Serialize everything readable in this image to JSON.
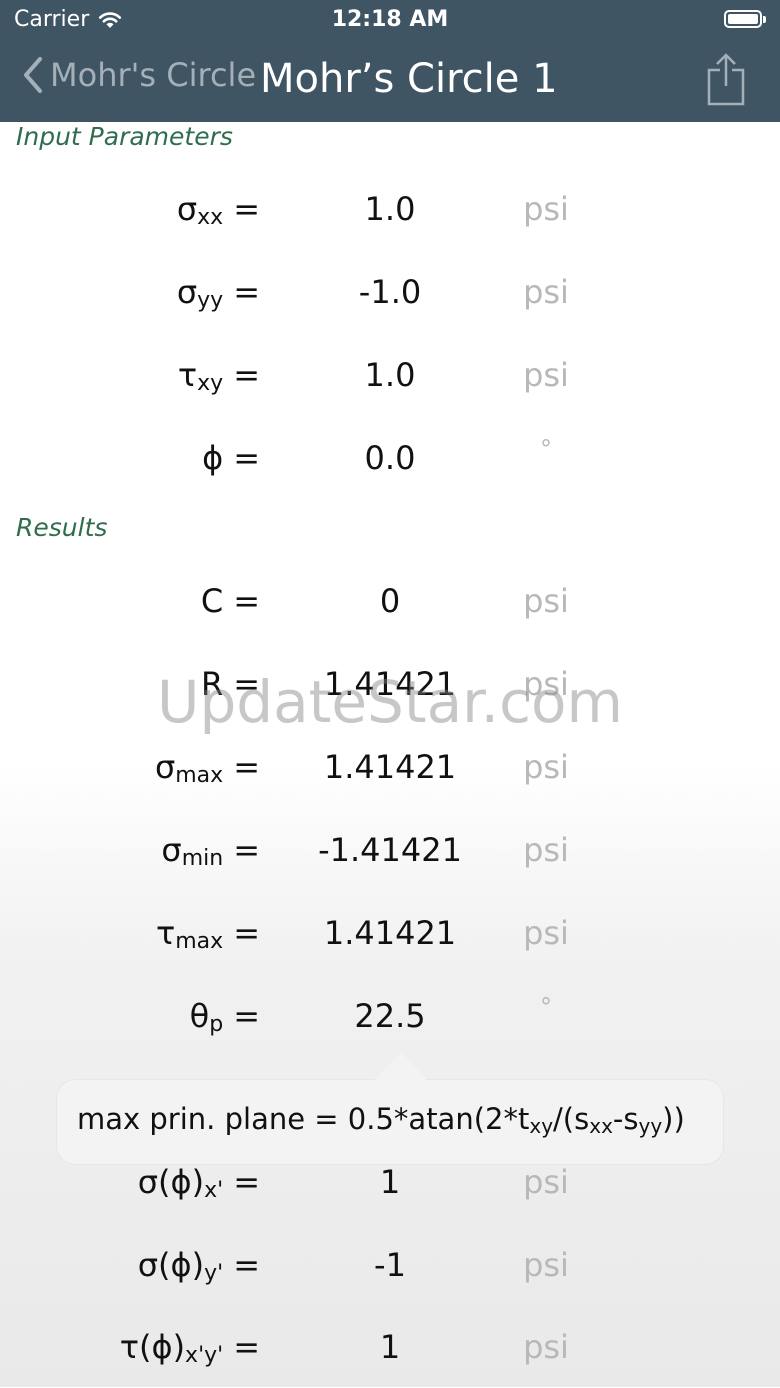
{
  "status_bar": {
    "carrier": "Carrier",
    "time": "12:18 AM"
  },
  "nav": {
    "back_label": "Mohr's Circle",
    "title": "Mohr’s Circle 1"
  },
  "input_section": {
    "header": "Input Parameters",
    "rows": [
      {
        "sym": "σ",
        "sub": "xx",
        "eq": "=",
        "value": "1.0",
        "unit": "psi"
      },
      {
        "sym": "σ",
        "sub": "yy",
        "eq": "=",
        "value": "-1.0",
        "unit": "psi"
      },
      {
        "sym": "τ",
        "sub": "xy",
        "eq": "=",
        "value": "1.0",
        "unit": "psi"
      },
      {
        "sym": "ϕ",
        "sub": "",
        "eq": "=",
        "value": "0.0",
        "unit": "°"
      }
    ]
  },
  "results_section": {
    "header": "Results",
    "rows": [
      {
        "sym": "C",
        "sub": "",
        "eq": "=",
        "value": "0",
        "unit": "psi"
      },
      {
        "sym": "R",
        "sub": "",
        "eq": "=",
        "value": "1.41421",
        "unit": "psi"
      },
      {
        "sym": "σ",
        "sub": "max",
        "eq": "=",
        "value": "1.41421",
        "unit": "psi"
      },
      {
        "sym": "σ",
        "sub": "min",
        "eq": "=",
        "value": "-1.41421",
        "unit": "psi"
      },
      {
        "sym": "τ",
        "sub": "max",
        "eq": "=",
        "value": "1.41421",
        "unit": "psi"
      },
      {
        "sym": "θ",
        "sub": "p",
        "eq": "=",
        "value": "22.5",
        "unit": "°"
      },
      {
        "sym": "σ(ϕ)",
        "sub": "x'",
        "eq": "=",
        "value": "1",
        "unit": "psi"
      },
      {
        "sym": "σ(ϕ)",
        "sub": "y'",
        "eq": "=",
        "value": "-1",
        "unit": "psi"
      },
      {
        "sym": "τ(ϕ)",
        "sub": "x'y'",
        "eq": "=",
        "value": "1",
        "unit": "psi"
      }
    ]
  },
  "tooltip": {
    "prefix": "max prin. plane = 0.5*atan(2*t",
    "sub1": "xy",
    "mid1": "/(s",
    "sub2": "xx",
    "mid2": "-s",
    "sub3": "yy",
    "suffix": "))"
  },
  "watermark": "UpdateStar.com"
}
